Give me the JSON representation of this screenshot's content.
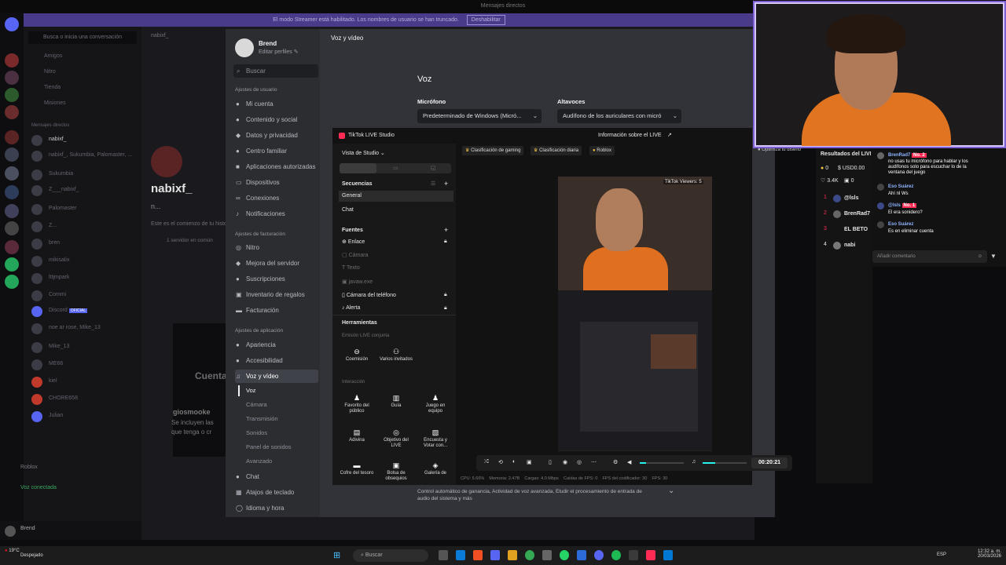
{
  "discord_bg": {
    "titlebar": "Mensajes directos",
    "banner_text": "El modo Streamer está habilitado. Los nombres de usuario se han truncado.",
    "banner_button": "Deshabilitar",
    "dm_search": "Busca o inicia una conversación",
    "nav": [
      "Amigos",
      "Nitro",
      "Tienda",
      "Misiones"
    ],
    "dm_header": "Mensajes directos",
    "dms": [
      "nabixf_",
      "nabixf_, Sukumbia, Palomaster, ...",
      "Sukumbia",
      "Z___nabixf_",
      "Palomaster",
      "Z...",
      "bren",
      "mikisalix",
      "lttjmpark",
      "Commi",
      "Discord",
      "noe ar rose, Mike_13",
      "Mike_13",
      "ME66",
      "kiel",
      "CHORE658",
      "Julian"
    ],
    "discord_official": "OFICIAL",
    "roblox": "Roblox",
    "voice_connected": "Voz conectada",
    "user": "Brend",
    "chat_header_user": "nabixf_",
    "chat_name": "nabixf_",
    "chat_sub": "n...",
    "chat_intro": "Este es el comienzo de tu histo...",
    "chat_server": "1 servidor en común",
    "cuenta": "Cuenta",
    "msg_user": "giosmooke",
    "msg_line1": "Se incluyen las",
    "msg_line2": "que tenga o cr"
  },
  "settings": {
    "profile_name": "Brend",
    "edit_profile": "Editar perfiles",
    "search_placeholder": "Buscar",
    "header_user": "Ajustes de usuario",
    "user_items": [
      "Mi cuenta",
      "Contenido y social",
      "Datos y privacidad",
      "Centro familiar",
      "Aplicaciones autorizadas",
      "Dispositivos",
      "Conexiones",
      "Notificaciones"
    ],
    "header_billing": "Ajustes de facturación",
    "billing_items": [
      "Nitro",
      "Mejora del servidor",
      "Suscripciones",
      "Inventario de regalos",
      "Facturación"
    ],
    "header_app": "Ajustes de aplicación",
    "app_items": [
      "Apariencia",
      "Accesibilidad",
      "Voz y vídeo"
    ],
    "voice_sub": [
      "Voz",
      "Cámara",
      "Transmisión",
      "Sonidos",
      "Panel de sonidos",
      "Avanzado"
    ],
    "more_items": [
      "Chat",
      "Atajos de teclado",
      "Idioma y hora"
    ],
    "breadcrumb": "Voz y vídeo",
    "section_title": "Voz",
    "mic_label": "Micrófono",
    "mic_value": "Predeterminado de Windows (Micró...",
    "speaker_label": "Altavoces",
    "speaker_value": "Audífono de los auriculares con micró",
    "footer_text": "Control automático de ganancia, Actividad de voz avanzada, Eludir el procesamiento de entrada de audio del sistema y más"
  },
  "tiktok": {
    "app_title": "TikTok LIVE Studio",
    "live_info": "Información sobre el LIVE",
    "studio_view": "Vista de Studio",
    "sequences": "Secuencias",
    "seq_items": [
      "General",
      "Chat"
    ],
    "sources": "Fuentes",
    "source_items": [
      "Enlace",
      "Cámara",
      "Texto",
      "javaw.exe",
      "Cámara del teléfono",
      "Alerta"
    ],
    "tools": "Herramientas",
    "co_live": "Emisión LIVE conjunta",
    "co_tiles": [
      "Coemisión",
      "Varios invitados"
    ],
    "interaction": "Interacción",
    "int_tiles": [
      "Favorito del público",
      "Guía",
      "Juego en equipo",
      "Adivina",
      "Objetivo del LIVE",
      "Encuesta y Votar con...",
      "Cofre del tesoro",
      "Bolsa de obsequios",
      "Galería de"
    ],
    "badges": [
      "Clasificación de gaming",
      "Clasificación diaria",
      "Roblox"
    ],
    "preview_overlay": "TikTok Viewers: 5",
    "timer": "00:20:21",
    "stats": {
      "cpu": "CPU: 5.66%",
      "memory": "Memoria: 2.47B",
      "load": "Cargas: 4.0 Mbps",
      "drops": "Caídas de FPS: 0",
      "encoder_fps": "FPS del codificador: 30",
      "fps": "FPS: 30"
    },
    "optimize": "Optimiza tu diseño",
    "results_title": "Resultados del LIVE",
    "coins": "0",
    "usd": "USD0.00",
    "likes": "3.4K",
    "viewers": "0",
    "ranking": [
      {
        "rank": "1",
        "name": "@lsls"
      },
      {
        "rank": "2",
        "name": "BrenRad7"
      },
      {
        "rank": "3",
        "name": "EL BETO"
      },
      {
        "rank": "4",
        "name": "nabi"
      }
    ],
    "chat": [
      {
        "user": "BrenRad7",
        "badge": "No. 2",
        "text": "no usas tu micrófono para hablar y los audífonos solo para escuchar lo de la ventana del juego"
      },
      {
        "user": "Eso Suárez",
        "badge": "",
        "text": "Ahí nl Ws"
      },
      {
        "user": "@lsls",
        "badge": "No. 1",
        "text": "El era sonidero?"
      },
      {
        "user": "Eso Suárez",
        "badge": "",
        "text": "Es en eliminar cuenta"
      }
    ],
    "comment_placeholder": "Añadir comentario"
  },
  "taskbar": {
    "weather_temp": "19°C",
    "weather_desc": "Despejado",
    "search": "Buscar",
    "lang": "ESP",
    "time": "12:32 a. m.",
    "date": "20/03/2026"
  }
}
